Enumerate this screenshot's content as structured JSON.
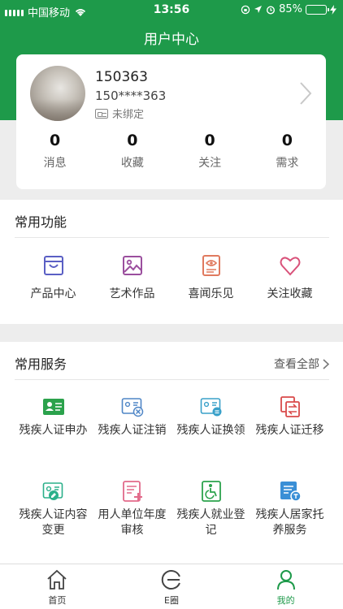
{
  "status_bar": {
    "carrier": "中国移动",
    "time": "13:56",
    "battery_percent": "85%",
    "battery_level": 0.85,
    "icons": [
      "signal-icon",
      "wifi-icon",
      "orientation-lock-icon",
      "location-icon",
      "alarm-icon",
      "battery-icon"
    ]
  },
  "header": {
    "title": "用户中心"
  },
  "profile": {
    "username": "150363",
    "phone": "150****363",
    "bind_status": "未绑定",
    "stats": [
      {
        "value": "0",
        "label": "消息"
      },
      {
        "value": "0",
        "label": "收藏"
      },
      {
        "value": "0",
        "label": "关注"
      },
      {
        "value": "0",
        "label": "需求"
      }
    ]
  },
  "functions": {
    "title": "常用功能",
    "items": [
      {
        "label": "产品中心",
        "icon": "shopping-bag-icon",
        "color": "#5a5fc4"
      },
      {
        "label": "艺术作品",
        "icon": "picture-icon",
        "color": "#9b4f9e"
      },
      {
        "label": "喜闻乐见",
        "icon": "document-eye-icon",
        "color": "#e07a5f"
      },
      {
        "label": "关注收藏",
        "icon": "heart-icon",
        "color": "#d9527a"
      }
    ]
  },
  "services": {
    "title": "常用服务",
    "more": "查看全部",
    "items": [
      {
        "label": "残疾人证申办",
        "icon": "id-card-icon",
        "color": "#2ba24c"
      },
      {
        "label": "残疾人证注销",
        "icon": "id-card-cancel-icon",
        "color": "#4f86c6"
      },
      {
        "label": "残疾人证换领",
        "icon": "id-card-exchange-icon",
        "color": "#39a0c9"
      },
      {
        "label": "残疾人证迁移",
        "icon": "transfer-icon",
        "color": "#d94a4a"
      },
      {
        "label": "残疾人证内容变更",
        "icon": "id-card-edit-icon",
        "color": "#2bb08a"
      },
      {
        "label": "用人单位年度审核",
        "icon": "document-add-icon",
        "color": "#e26a8a"
      },
      {
        "label": "残疾人就业登记",
        "icon": "wheelchair-icon",
        "color": "#2ba24c"
      },
      {
        "label": "残疾人居家托养服务",
        "icon": "document-badge-icon",
        "color": "#3a8fd6"
      }
    ]
  },
  "tabbar": {
    "active_color": "#1e9a4a",
    "tabs": [
      {
        "label": "首页",
        "icon": "home-icon"
      },
      {
        "label": "E圈",
        "icon": "e-circle-icon"
      },
      {
        "label": "我的",
        "icon": "profile-icon"
      }
    ]
  }
}
